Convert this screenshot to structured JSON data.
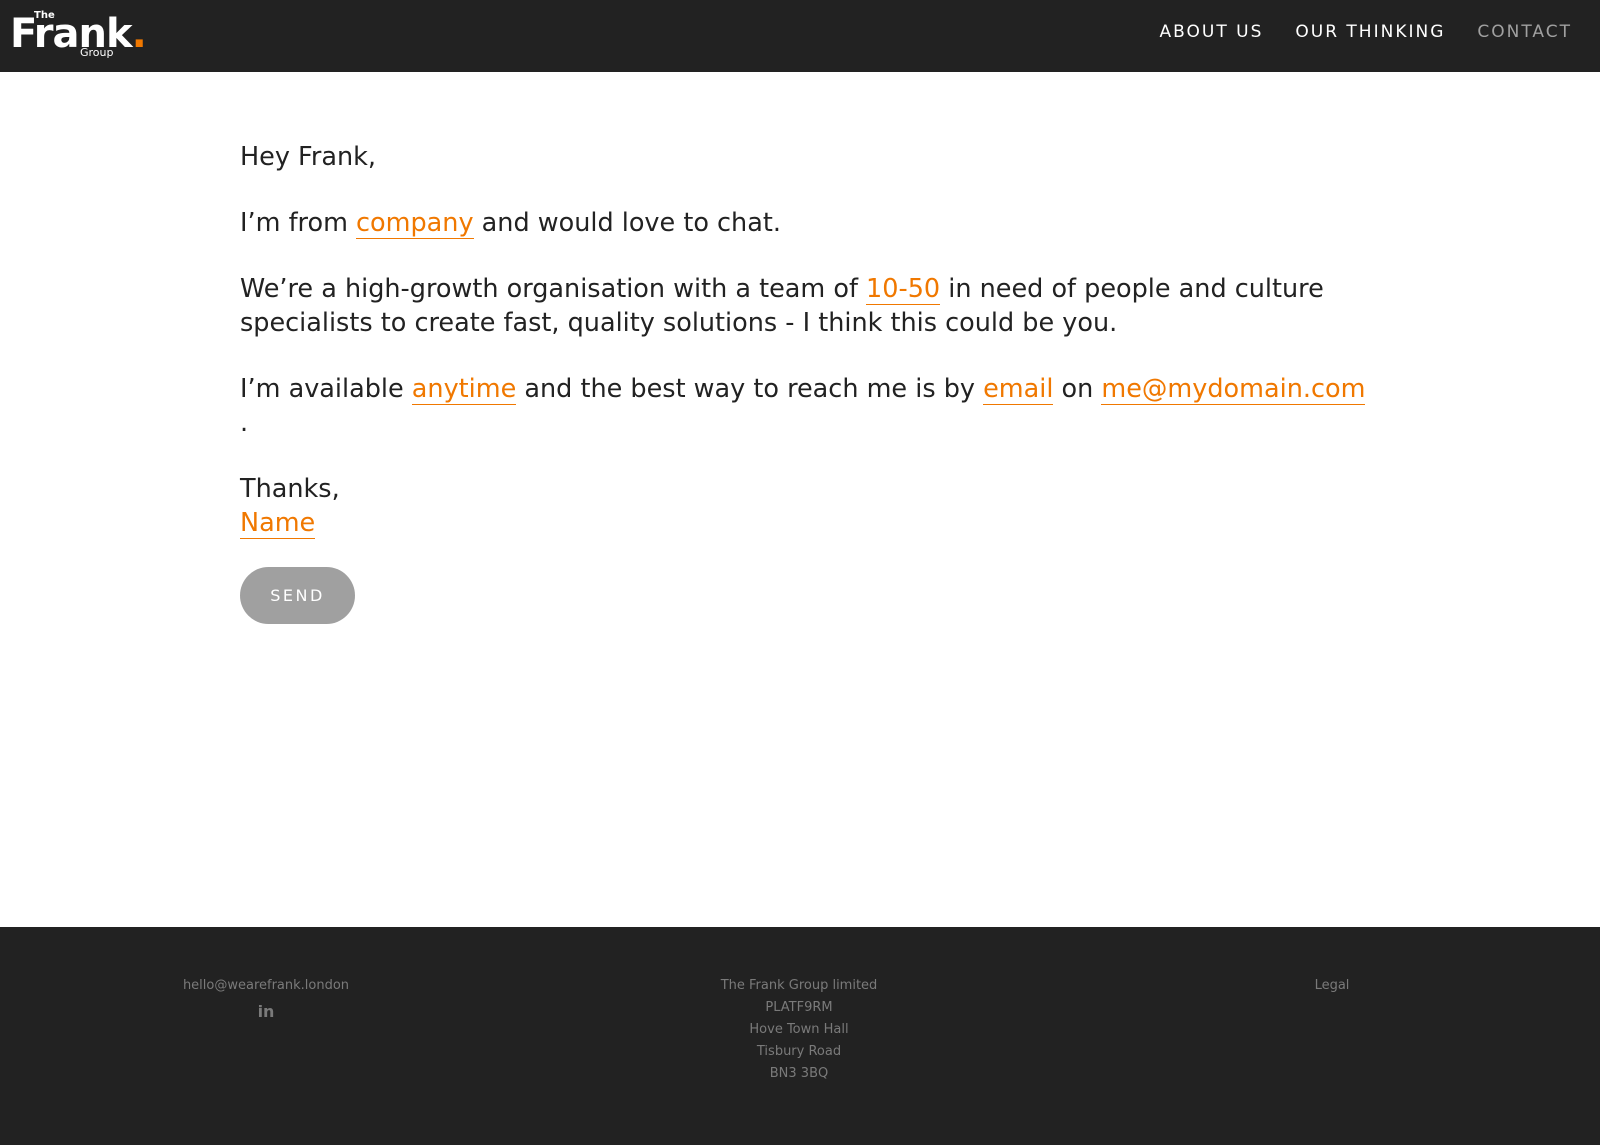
{
  "header": {
    "logo": {
      "the": "The",
      "frank": "Frank",
      "dot": ".",
      "group": "Group"
    },
    "nav": [
      {
        "label": "ABOUT US"
      },
      {
        "label": "OUR THINKING"
      },
      {
        "label": "CONTACT",
        "active": true
      }
    ]
  },
  "letter": {
    "greeting": "Hey Frank,",
    "line1": {
      "pre": "I’m from ",
      "company": "company",
      "post": " and would love to chat."
    },
    "line2": {
      "pre": "We’re a high-growth organisation with a team of ",
      "team_size": "10-50",
      "post": " in need of people and culture specialists to create fast, quality solutions - I think this could be you."
    },
    "line3": {
      "pre": "I’m available ",
      "availability": "anytime",
      "mid1": " and the best way to reach me is by ",
      "method": "email",
      "mid2": " on ",
      "contact": "me@mydomain.com",
      "post": "."
    },
    "signoff": "Thanks,",
    "name": "Name"
  },
  "send_label": "SEND",
  "footer": {
    "email": "hello@wearefrank.london",
    "linkedin_icon": "in",
    "address": [
      "The Frank Group limited",
      "PLATF9RM",
      "Hove Town Hall",
      "Tisbury Road",
      "BN3 3BQ"
    ],
    "legal": "Legal"
  },
  "colors": {
    "accent": "#f07800",
    "dark": "#222222",
    "muted": "#a0a0a0"
  }
}
